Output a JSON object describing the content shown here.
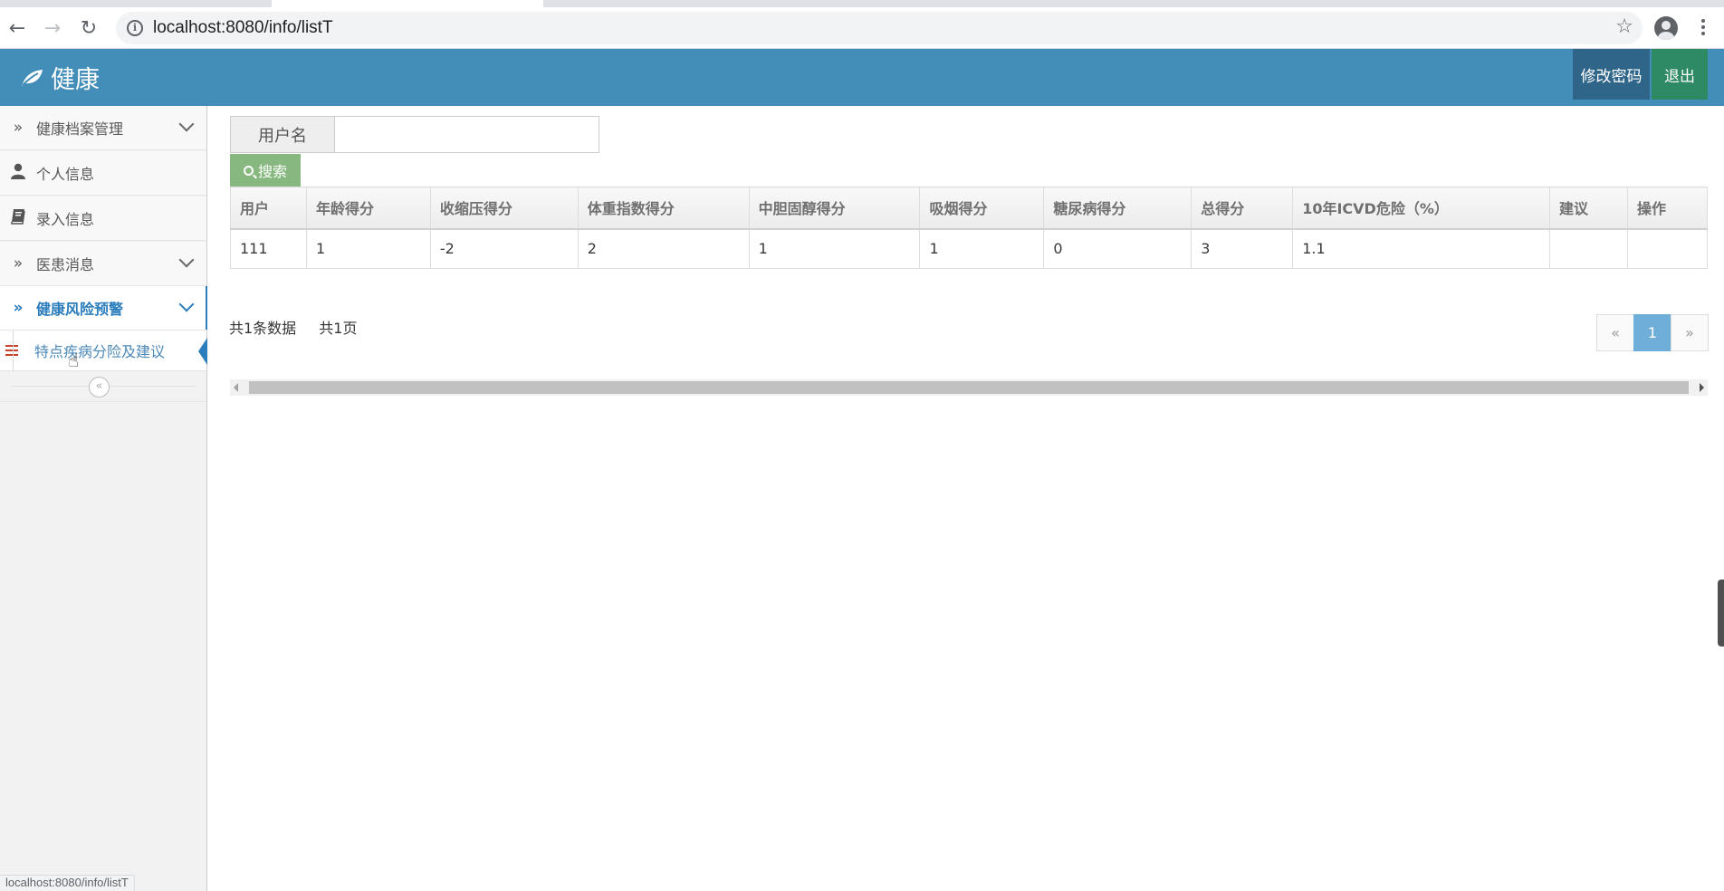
{
  "browser": {
    "url": "localhost:8080/info/listT",
    "status_url": "localhost:8080/info/listT"
  },
  "header": {
    "brand": "健康",
    "change_password": "修改密码",
    "logout": "退出",
    "colors": {
      "bar": "#438eb9",
      "password_button": "#2e6589",
      "logout_button": "#2e8965"
    }
  },
  "sidebar": {
    "items": [
      {
        "label": "健康档案管理",
        "icon": "double-chevron-icon",
        "expandable": true
      },
      {
        "label": "个人信息",
        "icon": "user-icon",
        "expandable": false
      },
      {
        "label": "录入信息",
        "icon": "book-icon",
        "expandable": false
      },
      {
        "label": "医患消息",
        "icon": "double-chevron-icon",
        "expandable": true
      },
      {
        "label": "健康风险预警",
        "icon": "double-chevron-icon",
        "expandable": true,
        "open": true
      }
    ],
    "sub_item": {
      "label": "特点疾病分险及建议",
      "icon": "list-icon"
    },
    "collapse_icon": "double-chevron-left-icon"
  },
  "search": {
    "label": "用户名",
    "value": "",
    "placeholder": "",
    "button": "搜索"
  },
  "table": {
    "headers": [
      "用户",
      "年龄得分",
      "收缩压得分",
      "体重指数得分",
      "中胆固醇得分",
      "吸烟得分",
      "糖尿病得分",
      "总得分",
      "10年ICVD危险（%）",
      "建议",
      "操作"
    ],
    "rows": [
      [
        "111",
        "1",
        "-2",
        "2",
        "1",
        "1",
        "0",
        "3",
        "1.1",
        "",
        ""
      ]
    ]
  },
  "pagination": {
    "total_records": "共1条数据",
    "total_pages": "共1页",
    "prev": "«",
    "current": "1",
    "next": "»"
  }
}
